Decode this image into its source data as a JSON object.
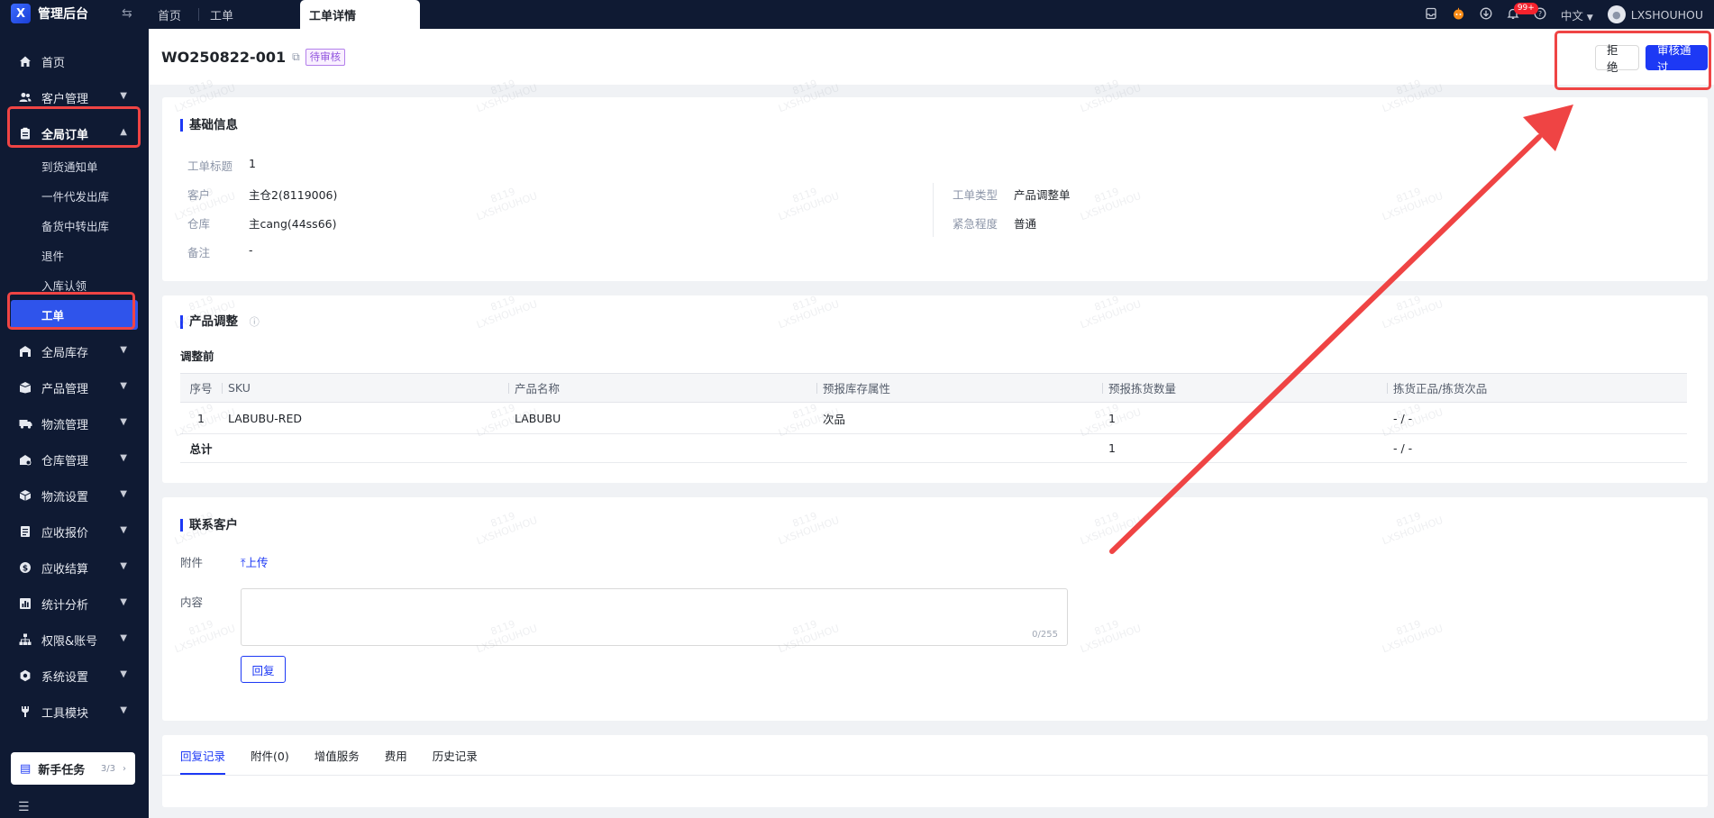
{
  "app": {
    "title": "管理后台"
  },
  "tabs": [
    {
      "label": "首页"
    },
    {
      "label": "工单"
    },
    {
      "label": "工单详情"
    }
  ],
  "topbar": {
    "notification_count": "99+",
    "language": "中文",
    "username": "LXSHOUHOU"
  },
  "sidebar": {
    "items": [
      {
        "label": "首页",
        "icon": "home-icon"
      },
      {
        "label": "客户管理",
        "icon": "users-icon"
      },
      {
        "label": "全局订单",
        "icon": "clipboard-icon"
      },
      {
        "label": "全局库存",
        "icon": "warehouse-icon"
      },
      {
        "label": "产品管理",
        "icon": "box-icon"
      },
      {
        "label": "物流管理",
        "icon": "truck-icon"
      },
      {
        "label": "仓库管理",
        "icon": "storage-icon"
      },
      {
        "label": "物流设置",
        "icon": "cube-icon"
      },
      {
        "label": "应收报价",
        "icon": "document-icon"
      },
      {
        "label": "应收结算",
        "icon": "dollar-icon"
      },
      {
        "label": "统计分析",
        "icon": "chart-icon"
      },
      {
        "label": "权限&账号",
        "icon": "org-icon"
      },
      {
        "label": "系统设置",
        "icon": "settings-icon"
      },
      {
        "label": "工具模块",
        "icon": "tool-icon"
      }
    ],
    "order_subitems": [
      {
        "label": "到货通知单"
      },
      {
        "label": "一件代发出库"
      },
      {
        "label": "备货中转出库"
      },
      {
        "label": "退件"
      },
      {
        "label": "入库认领"
      },
      {
        "label": "工单"
      }
    ],
    "task": {
      "label": "新手任务",
      "count": "3/3"
    }
  },
  "header": {
    "code": "WO250822-001",
    "status": "待审核",
    "reject_label": "拒绝",
    "approve_label": "审核通过"
  },
  "basic_info": {
    "title": "基础信息",
    "fields": {
      "subject": {
        "label": "工单标题",
        "value": "1"
      },
      "customer": {
        "label": "客户",
        "value": "主仓2(8119006)"
      },
      "warehouse": {
        "label": "仓库",
        "value": "主cang(44ss66)"
      },
      "remark": {
        "label": "备注",
        "value": "-"
      },
      "type": {
        "label": "工单类型",
        "value": "产品调整单"
      },
      "urgency": {
        "label": "紧急程度",
        "value": "普通"
      }
    }
  },
  "product_adjust": {
    "title": "产品调整",
    "subtitle": "调整前",
    "columns": [
      "序号",
      "SKU",
      "产品名称",
      "预报库存属性",
      "预报拣货数量",
      "拣货正品/拣货次品"
    ],
    "rows": [
      {
        "idx": "1",
        "sku": "LABUBU-RED",
        "name": "LABUBU",
        "attr": "次品",
        "qty": "1",
        "pick": "- / -"
      }
    ],
    "total": {
      "label": "总计",
      "qty": "1",
      "pick": "- / -"
    }
  },
  "contact": {
    "title": "联系客户",
    "attachment_label": "附件",
    "upload_label": "上传",
    "content_label": "内容",
    "counter": "0/255",
    "reply_label": "回复"
  },
  "bottom_tabs": [
    {
      "label": "回复记录"
    },
    {
      "label": "附件(0)"
    },
    {
      "label": "增值服务"
    },
    {
      "label": "费用"
    },
    {
      "label": "历史记录"
    }
  ],
  "watermark": {
    "line1": "8119",
    "line2": "LXSHOUHOU"
  },
  "colors": {
    "accent": "#1d39f5",
    "sidebar": "#0f1a33",
    "highlight": "#ef4444",
    "status": "#9254de"
  }
}
